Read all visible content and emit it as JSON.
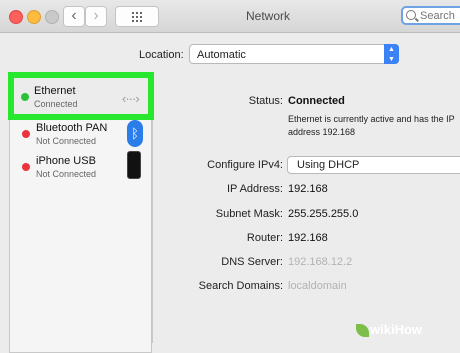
{
  "window": {
    "title": "Network"
  },
  "toolbar": {
    "back_glyph": "‹",
    "forward_glyph": "›",
    "search_placeholder": "Search"
  },
  "location": {
    "label": "Location:",
    "value": "Automatic"
  },
  "sidebar": {
    "items": [
      {
        "name": "Ethernet",
        "status": "Connected",
        "dot": "green",
        "icon": "ethernet-arrows-icon",
        "selected": true
      },
      {
        "name": "Bluetooth PAN",
        "status": "Not Connected",
        "dot": "red",
        "icon": "bluetooth-icon"
      },
      {
        "name": "iPhone USB",
        "status": "Not Connected",
        "dot": "red",
        "icon": "iphone-icon"
      }
    ]
  },
  "details": {
    "status_label": "Status:",
    "status_value": "Connected",
    "status_desc": "Ethernet is currently active and has the IP address 192.168",
    "ipv4_label": "Configure IPv4:",
    "ipv4_value": "Using DHCP",
    "ip_label": "IP Address:",
    "ip_value": "192.168",
    "subnet_label": "Subnet Mask:",
    "subnet_value": "255.255.255.0",
    "router_label": "Router:",
    "router_value": "192.168",
    "dns_label": "DNS Server:",
    "dns_value": "192.168.12.2",
    "search_domains_label": "Search Domains:",
    "search_domains_value": "localdomain"
  },
  "watermark": {
    "text": "wikiHow"
  },
  "colors": {
    "highlight": "#27e82e",
    "connected": "#2bc13b",
    "not_connected": "#e8343a",
    "accent": "#3b82f6"
  }
}
